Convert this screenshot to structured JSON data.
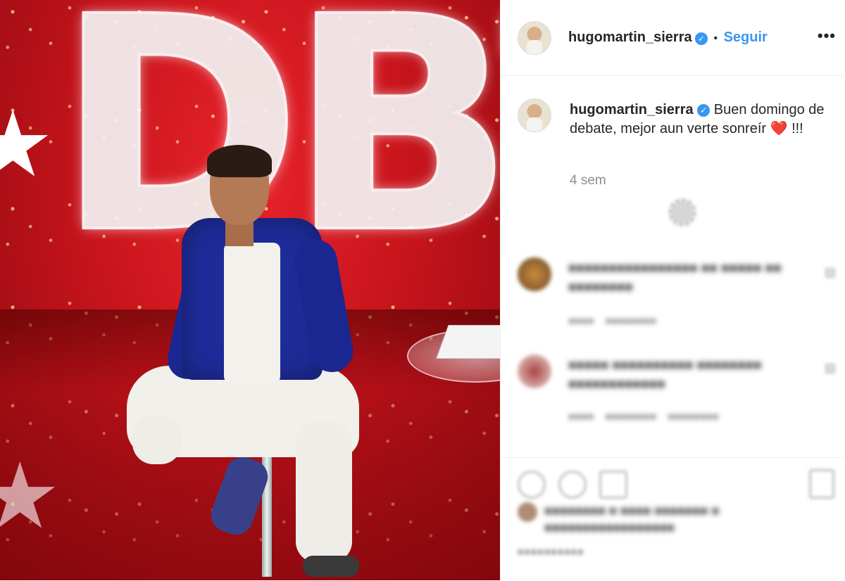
{
  "post": {
    "photo_alt": "Man in blue jacket seated on stool in front of red DBT set",
    "set_letters": "DBT"
  },
  "header": {
    "username": "hugomartin_sierra",
    "verified_mark": "✓",
    "separator": "•",
    "follow_label": "Seguir",
    "more_label": "•••"
  },
  "caption": {
    "username": "hugomartin_sierra",
    "verified_mark": "✓",
    "text": "Buen domingo de debate, mejor aun verte sonreír",
    "emoji": "❤️",
    "suffix": " !!!",
    "time": "4 sem"
  },
  "comments": [
    {
      "text": "■■■■■■■■■■■■■■■■ ■■ ■■■■■ ■■ ■■■■■■■■",
      "meta": "■■■■ ■■■■■■■■"
    },
    {
      "text": "■■■■■ ■■■■■■■■■■ ■■■■■■■■ ■■■■■■■■■■■■",
      "meta": "■■■■ ■■■■■■■■ ■■■■■■■■"
    }
  ],
  "likes": {
    "text": "■■■■■■■■ ■ ■■■■ ■■■■■■■ ■ ■■■■■■■■■■■■■■■■■"
  },
  "date": "■■■■■■■■■■",
  "colors": {
    "accent": "#3897f0",
    "set_red": "#c8141c",
    "jacket_blue": "#1e2c9a"
  },
  "icons": [
    "more-options-icon",
    "verified-icon",
    "heart-icon",
    "comment-icon",
    "share-icon",
    "bookmark-icon"
  ]
}
